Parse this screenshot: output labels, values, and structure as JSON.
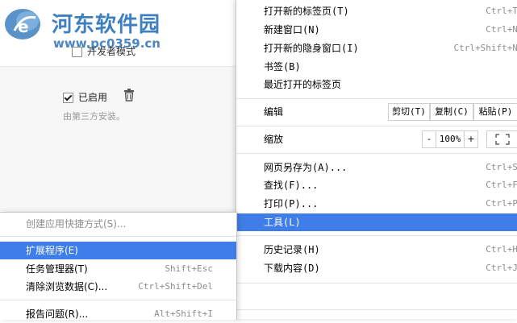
{
  "watermark": {
    "site_name": "河东软件园",
    "url": "www.pc0359.cn"
  },
  "extensions_page": {
    "developer_mode_label": "开发者模式",
    "enabled_label": "已启用",
    "extension_description": "由第三方安装。"
  },
  "main_menu": {
    "items": [
      {
        "label": "打开新的标签页",
        "accel": "T",
        "shortcut": "Ctrl+T"
      },
      {
        "label": "新建窗口",
        "accel": "N",
        "shortcut": "Ctrl+N"
      },
      {
        "label": "打开新的隐身窗口",
        "accel": "I",
        "shortcut": "Ctrl+Shift+N"
      },
      {
        "label": "书签",
        "accel": "B",
        "shortcut": ""
      },
      {
        "label": "最近打开的标签页",
        "accel": "",
        "shortcut": ""
      }
    ],
    "edit": {
      "label": "编辑",
      "cut": "剪切(T)",
      "copy": "复制(C)",
      "paste": "粘贴(P)"
    },
    "zoom": {
      "label": "缩放",
      "minus": "-",
      "value": "100%",
      "plus": "+"
    },
    "items2": [
      {
        "label": "网页另存为",
        "accel": "A",
        "suffix": "...",
        "shortcut": "Ctrl+S"
      },
      {
        "label": "查找",
        "accel": "F",
        "suffix": "...",
        "shortcut": "Ctrl+F"
      },
      {
        "label": "打印",
        "accel": "P",
        "suffix": "...",
        "shortcut": "Ctrl+P"
      },
      {
        "label": "工具",
        "accel": "L",
        "suffix": "",
        "shortcut": ""
      }
    ],
    "items3": [
      {
        "label": "历史记录",
        "accel": "H",
        "shortcut": "Ctrl+H"
      },
      {
        "label": "下载内容",
        "accel": "D",
        "shortcut": "Ctrl+J"
      }
    ]
  },
  "tools_submenu": {
    "items": [
      {
        "label": "创建应用快捷方式(S)...",
        "shortcut": ""
      },
      {
        "label": "扩展程序(E)",
        "shortcut": ""
      },
      {
        "label": "任务管理器(T)",
        "shortcut": "Shift+Esc"
      },
      {
        "label": "清除浏览数据(C)...",
        "shortcut": "Ctrl+Shift+Del"
      },
      {
        "label": "报告问题(R)...",
        "shortcut": "Alt+Shift+I"
      }
    ]
  },
  "colors": {
    "highlight": "#3f7ee8",
    "watermark_blue": "#3d7fbf"
  }
}
